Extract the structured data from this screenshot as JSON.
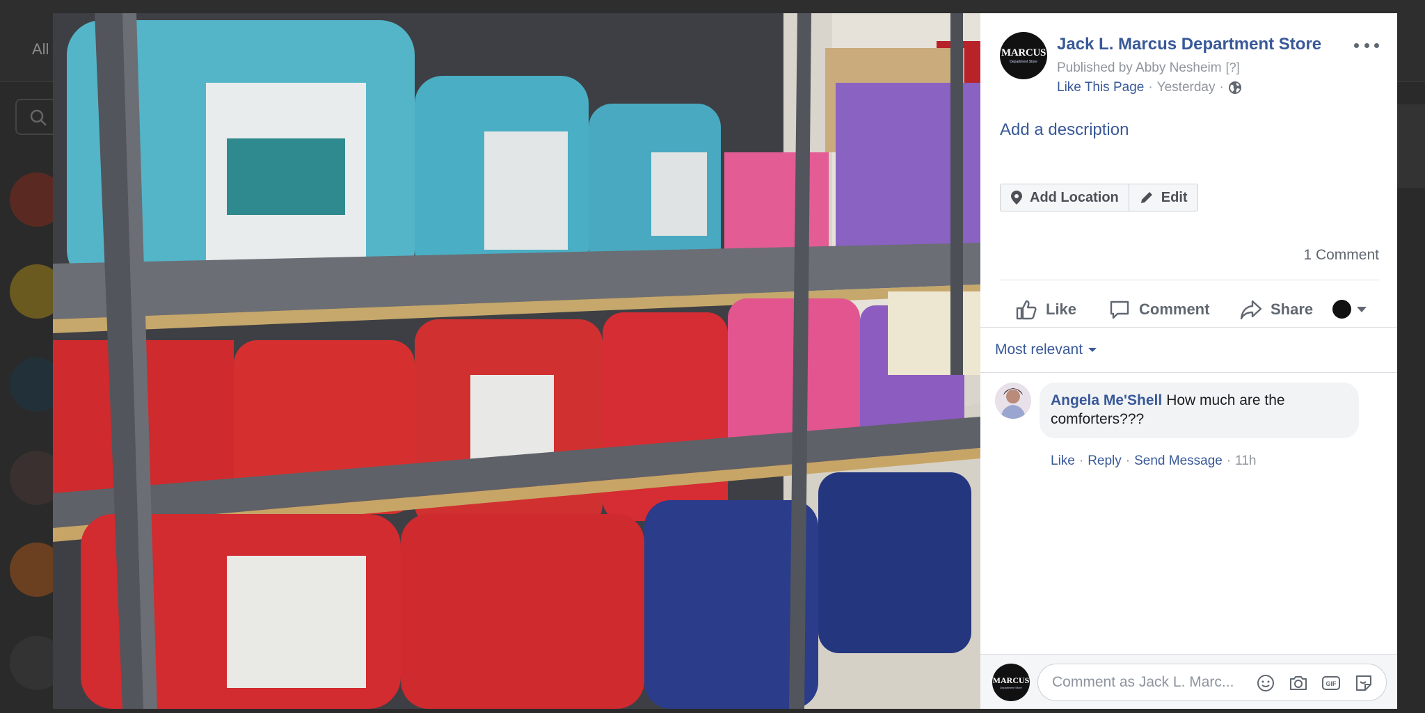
{
  "background": {
    "nav_label": "All"
  },
  "post": {
    "page_name": "Jack L. Marcus Department Store",
    "published_by": "Published by Abby Nesheim",
    "help_marker": "[?]",
    "like_page": "Like This Page",
    "time": "Yesterday",
    "privacy_icon": "globe-icon",
    "add_description": "Add a description",
    "add_location": "Add Location",
    "edit": "Edit",
    "comment_count": "1 Comment",
    "avatar_logo": "MARCUS",
    "avatar_subtitle": "Department Store"
  },
  "ufi": {
    "like": "Like",
    "comment": "Comment",
    "share": "Share",
    "sort": "Most relevant"
  },
  "comments": [
    {
      "author": "Angela Me'Shell",
      "text": "How much are the comforters???",
      "actions": {
        "like": "Like",
        "reply": "Reply",
        "send_message": "Send Message",
        "time": "11h"
      }
    }
  ],
  "composer": {
    "placeholder": "Comment as Jack L. Marc...",
    "icons": [
      "emoji-icon",
      "camera-icon",
      "gif-icon",
      "sticker-icon"
    ]
  },
  "colors": {
    "link": "#385898",
    "meta": "#90949c",
    "photo_red": "#d62a2e",
    "photo_teal": "#4fb3c8",
    "photo_pink": "#e04b8a",
    "photo_purple": "#8b5fc1",
    "photo_navy": "#24367e"
  }
}
